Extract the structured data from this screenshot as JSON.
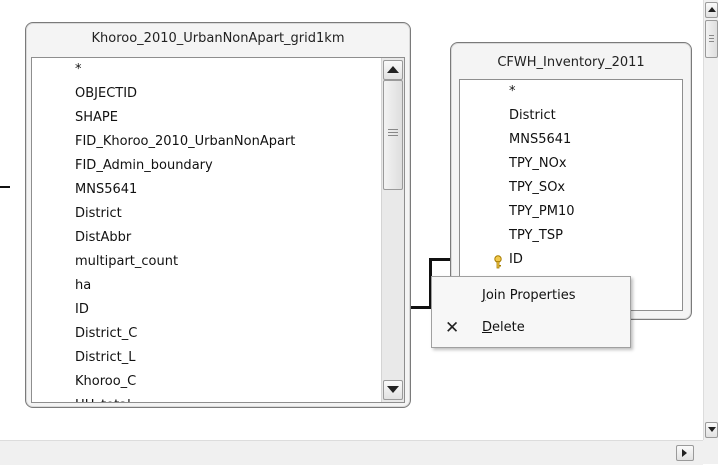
{
  "tables": [
    {
      "title": "Khoroo_2010_UrbanNonApart_grid1km",
      "fields": [
        "*",
        "OBJECTID",
        "SHAPE",
        "FID_Khoroo_2010_UrbanNonApart",
        "FID_Admin_boundary",
        "MNS5641",
        "District",
        "DistAbbr",
        "multipart_count",
        "ha",
        "ID",
        "District_C",
        "District_L",
        "Khoroo_C",
        "HH_total"
      ]
    },
    {
      "title": "CFWH_Inventory_2011",
      "fields": [
        "*",
        "District",
        "MNS5641",
        "TPY_NOx",
        "TPY_SOx",
        "TPY_PM10",
        "TPY_TSP",
        "ID"
      ],
      "key_field": "ID",
      "key_icon": "primary-key-icon"
    }
  ],
  "context_menu": {
    "items": [
      {
        "label": "Join Properties",
        "icon": ""
      },
      {
        "label": "Delete",
        "icon": "close-icon"
      }
    ]
  }
}
